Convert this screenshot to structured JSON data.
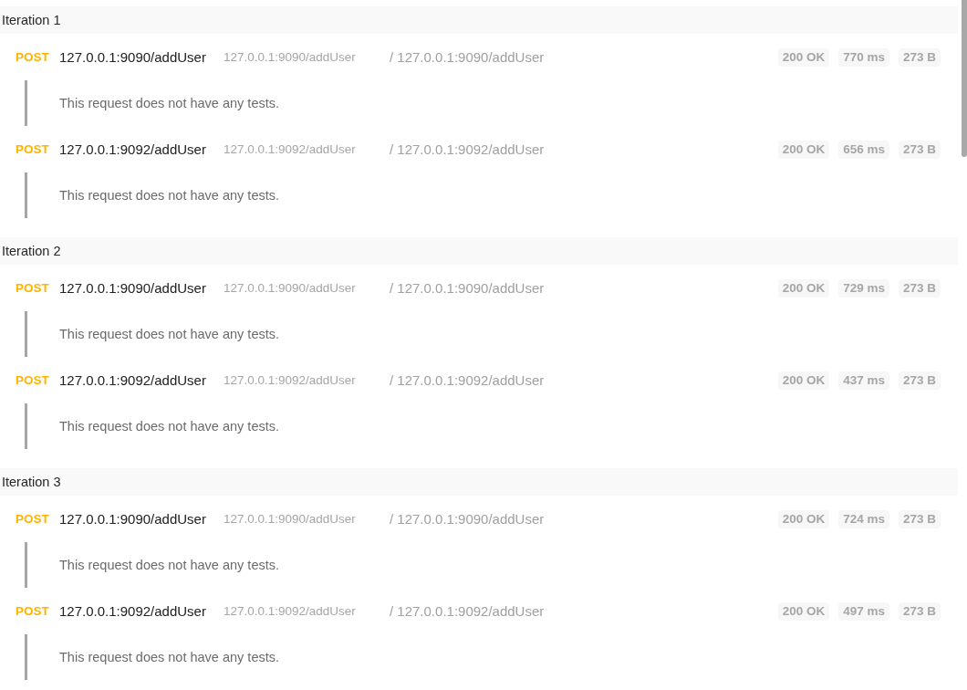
{
  "iterations": [
    {
      "title": "Iteration 1",
      "requests": [
        {
          "method": "POST",
          "name": "127.0.0.1:9090/addUser",
          "url": "127.0.0.1:9090/addUser",
          "path": "/ 127.0.0.1:9090/addUser",
          "status": "200 OK",
          "time": "770 ms",
          "size": "273 B",
          "tests_message": "This request does not have any tests."
        },
        {
          "method": "POST",
          "name": "127.0.0.1:9092/addUser",
          "url": "127.0.0.1:9092/addUser",
          "path": "/ 127.0.0.1:9092/addUser",
          "status": "200 OK",
          "time": "656 ms",
          "size": "273 B",
          "tests_message": "This request does not have any tests."
        }
      ]
    },
    {
      "title": "Iteration 2",
      "requests": [
        {
          "method": "POST",
          "name": "127.0.0.1:9090/addUser",
          "url": "127.0.0.1:9090/addUser",
          "path": "/ 127.0.0.1:9090/addUser",
          "status": "200 OK",
          "time": "729 ms",
          "size": "273 B",
          "tests_message": "This request does not have any tests."
        },
        {
          "method": "POST",
          "name": "127.0.0.1:9092/addUser",
          "url": "127.0.0.1:9092/addUser",
          "path": "/ 127.0.0.1:9092/addUser",
          "status": "200 OK",
          "time": "437 ms",
          "size": "273 B",
          "tests_message": "This request does not have any tests."
        }
      ]
    },
    {
      "title": "Iteration 3",
      "requests": [
        {
          "method": "POST",
          "name": "127.0.0.1:9090/addUser",
          "url": "127.0.0.1:9090/addUser",
          "path": "/ 127.0.0.1:9090/addUser",
          "status": "200 OK",
          "time": "724 ms",
          "size": "273 B",
          "tests_message": "This request does not have any tests."
        },
        {
          "method": "POST",
          "name": "127.0.0.1:9092/addUser",
          "url": "127.0.0.1:9092/addUser",
          "path": "/ 127.0.0.1:9092/addUser",
          "status": "200 OK",
          "time": "497 ms",
          "size": "273 B",
          "tests_message": "This request does not have any tests."
        }
      ]
    }
  ]
}
